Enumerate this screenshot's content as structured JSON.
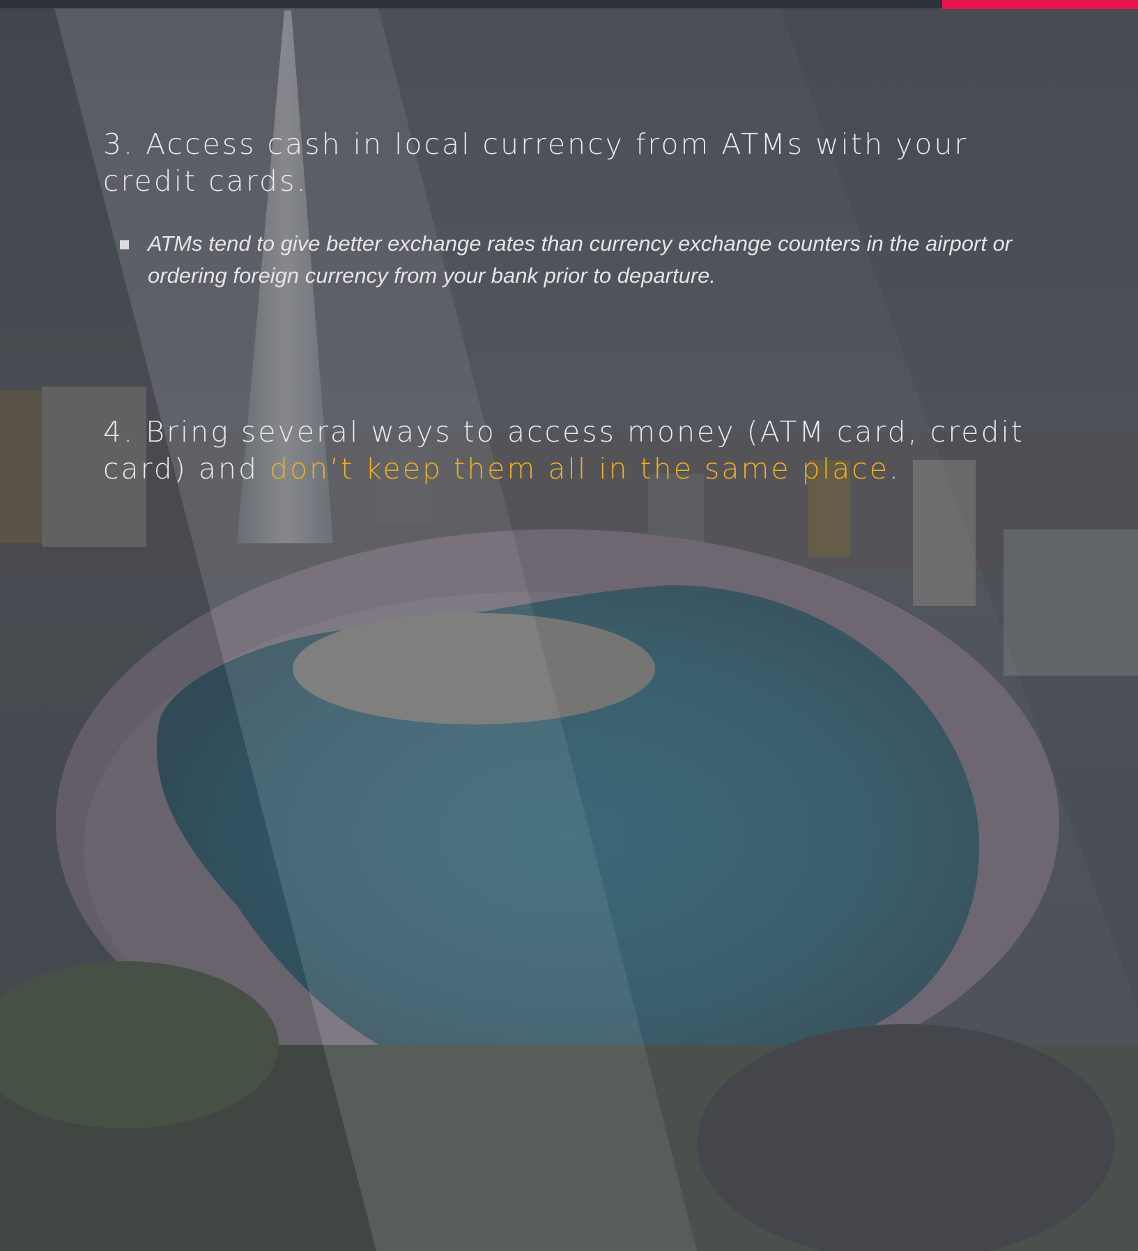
{
  "slide": {
    "accent_color": "#e8144c",
    "highlight_color": "#f2b01b",
    "background_image": "aerial-lake-city-photo",
    "tip3": {
      "heading": "3. Access cash in local currency from ATMs with your credit cards.",
      "bullet_icon": "square-bullet-icon",
      "bullet": "ATMs tend to give better exchange rates than currency exchange counters in the airport or ordering foreign currency from your bank prior to departure."
    },
    "tip4": {
      "heading_prefix": "4. Bring several ways to access money (ATM card, credit card) and ",
      "heading_highlight": "don’t keep them all in the same place",
      "heading_suffix": "."
    }
  }
}
